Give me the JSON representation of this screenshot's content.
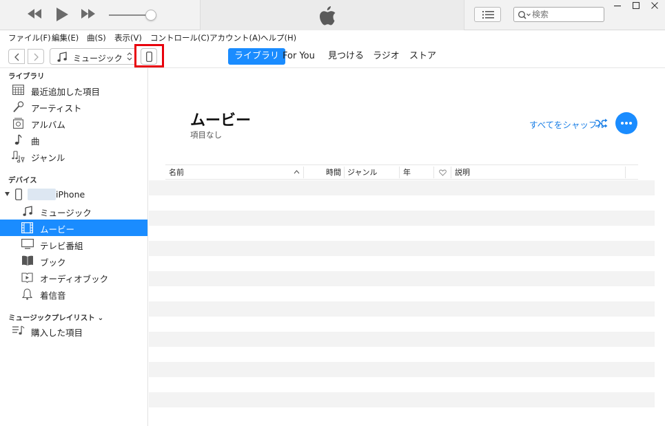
{
  "search": {
    "placeholder": "検索"
  },
  "menu": [
    {
      "label": "ファイル(F)"
    },
    {
      "label": "編集(E)"
    },
    {
      "label": "曲(S)"
    },
    {
      "label": "表示(V)"
    },
    {
      "label": "コントロール(C)"
    },
    {
      "label": "アカウント(A)"
    },
    {
      "label": "ヘルプ(H)"
    }
  ],
  "navbar": {
    "media_kind": "ミュージック",
    "tabs": [
      {
        "label": "ライブラリ",
        "active": true
      },
      {
        "label": "For You"
      },
      {
        "label": "見つける"
      },
      {
        "label": "ラジオ"
      },
      {
        "label": "ストア"
      }
    ],
    "highlight_color": "#e8000b"
  },
  "sidebar": {
    "library_header": "ライブラリ",
    "library_items": [
      {
        "label": "最近追加した項目",
        "icon": "grid-calendar-icon"
      },
      {
        "label": "アーティスト",
        "icon": "microphone-icon"
      },
      {
        "label": "アルバム",
        "icon": "album-icon"
      },
      {
        "label": "曲",
        "icon": "note-icon"
      },
      {
        "label": "ジャンル",
        "icon": "genre-icon"
      }
    ],
    "devices_header": "デバイス",
    "device_name": "iPhone",
    "device_items": [
      {
        "label": "ミュージック",
        "icon": "note-icon"
      },
      {
        "label": "ムービー",
        "icon": "film-icon",
        "selected": true
      },
      {
        "label": "テレビ番組",
        "icon": "tv-icon"
      },
      {
        "label": "ブック",
        "icon": "book-icon"
      },
      {
        "label": "オーディオブック",
        "icon": "audiobook-icon"
      },
      {
        "label": "着信音",
        "icon": "bell-icon"
      }
    ],
    "playlists_header": "ミュージックプレイリスト ⌄",
    "playlist_items": [
      {
        "label": "購入した項目",
        "icon": "playlist-icon"
      }
    ]
  },
  "main": {
    "title": "ムービー",
    "subtitle": "項目なし",
    "shuffle_label": "すべてをシャッフル",
    "columns": {
      "name": "名前",
      "time": "時間",
      "genre": "ジャンル",
      "year": "年",
      "description": "説明"
    }
  },
  "colors": {
    "accent": "#1a8cff",
    "link": "#1a7fe6"
  }
}
